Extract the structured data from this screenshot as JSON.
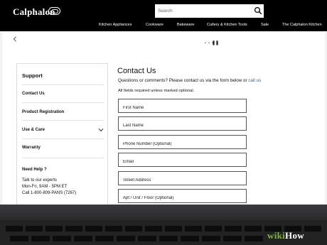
{
  "brand": "Calphalon",
  "search": {
    "placeholder": "Search"
  },
  "nav": [
    "Kitchen Appliances",
    "Cookware",
    "Bakeware",
    "Cutlery & Kitchen Tools",
    "Sale",
    "The Calphalon Kitchen"
  ],
  "loader": "• • •",
  "sidebar": {
    "title": "Support",
    "items": [
      "Contact Us",
      "Product Registration",
      "Use & Care",
      "Warranty"
    ],
    "help": {
      "title": "Need Help ?",
      "lines": [
        "Talk to our experts",
        "Mon-Fri, 9AM - 5PM ET",
        "Call 1-800-809-PANS (7267)"
      ]
    }
  },
  "main": {
    "title": "Contact Us",
    "intro": "Questions or comments? Please contact us via the form below or",
    "call_link": "call us",
    "required_note": "All fields required unless marked optional.",
    "fields": [
      "First Name",
      "Last Name",
      "Phone Number (Optional)",
      "Email",
      "Street Address",
      "Apt / Unit / Floor (Optional)"
    ]
  },
  "watermark": {
    "part1": "wiki",
    "part2": "How"
  },
  "colors": {
    "topbar": "#000000",
    "link": "#3a5f8f",
    "watermark_accent": "#7eb43b"
  },
  "icons": [
    "calphalon-logo-icon",
    "search-icon",
    "back-chevron-icon",
    "chevron-down-icon"
  ]
}
